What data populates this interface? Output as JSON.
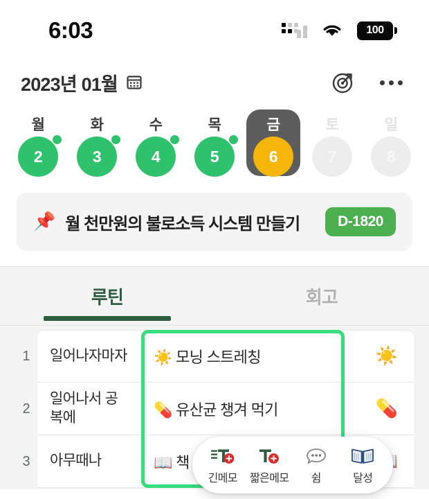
{
  "status_bar": {
    "time": "6:03",
    "signal_icon": "signal-dots-icon",
    "wifi_icon": "wifi-icon",
    "battery_level": "100",
    "battery_icon": "battery-full-icon"
  },
  "header": {
    "title": "2023년 01월",
    "calendar_icon": "calendar-icon",
    "goal_icon": "target-icon",
    "more_icon": "more-options-icon"
  },
  "week": {
    "days": [
      {
        "label": "월",
        "date": "2",
        "state": "done",
        "has_dot": true
      },
      {
        "label": "화",
        "date": "3",
        "state": "done",
        "has_dot": true
      },
      {
        "label": "수",
        "date": "4",
        "state": "done",
        "has_dot": true
      },
      {
        "label": "목",
        "date": "5",
        "state": "done",
        "has_dot": true
      },
      {
        "label": "금",
        "date": "6",
        "state": "selected",
        "has_dot": false
      },
      {
        "label": "토",
        "date": "7",
        "state": "muted",
        "has_dot": false
      },
      {
        "label": "일",
        "date": "8",
        "state": "muted",
        "has_dot": false
      }
    ]
  },
  "goal": {
    "pin_icon": "pushpin-icon",
    "pin_emoji": "📌",
    "text": "월 천만원의 불로소득 시스템 만들기",
    "badge": "D-1820"
  },
  "tabs": [
    {
      "label": "루틴",
      "active": true
    },
    {
      "label": "회고",
      "active": false
    }
  ],
  "routines": [
    {
      "num": "1",
      "when": "일어나자마자",
      "task": "☀️ 모닝 스트레칭",
      "icon": "☀️"
    },
    {
      "num": "2",
      "when": "일어나서 공복에",
      "task": "💊 유산균 챙겨 먹기",
      "icon": "💊"
    },
    {
      "num": "3",
      "when": "아무때나",
      "task": "📖 책",
      "icon": "📖"
    }
  ],
  "action_menu": {
    "items": [
      {
        "label": "긴메모",
        "icon": "long-memo-add-icon"
      },
      {
        "label": "짧은메모",
        "icon": "short-memo-add-icon"
      },
      {
        "label": "쉼",
        "icon": "rest-bubble-icon"
      },
      {
        "label": "달성",
        "icon": "achieve-book-icon"
      }
    ]
  },
  "colors": {
    "green": "#2dc26b",
    "orange": "#f5b50a",
    "highlight_green": "#37dd7c",
    "badge_green": "#4caf50",
    "tab_green": "#2f5d3f",
    "selected_day_bg": "#5d5d5d"
  }
}
